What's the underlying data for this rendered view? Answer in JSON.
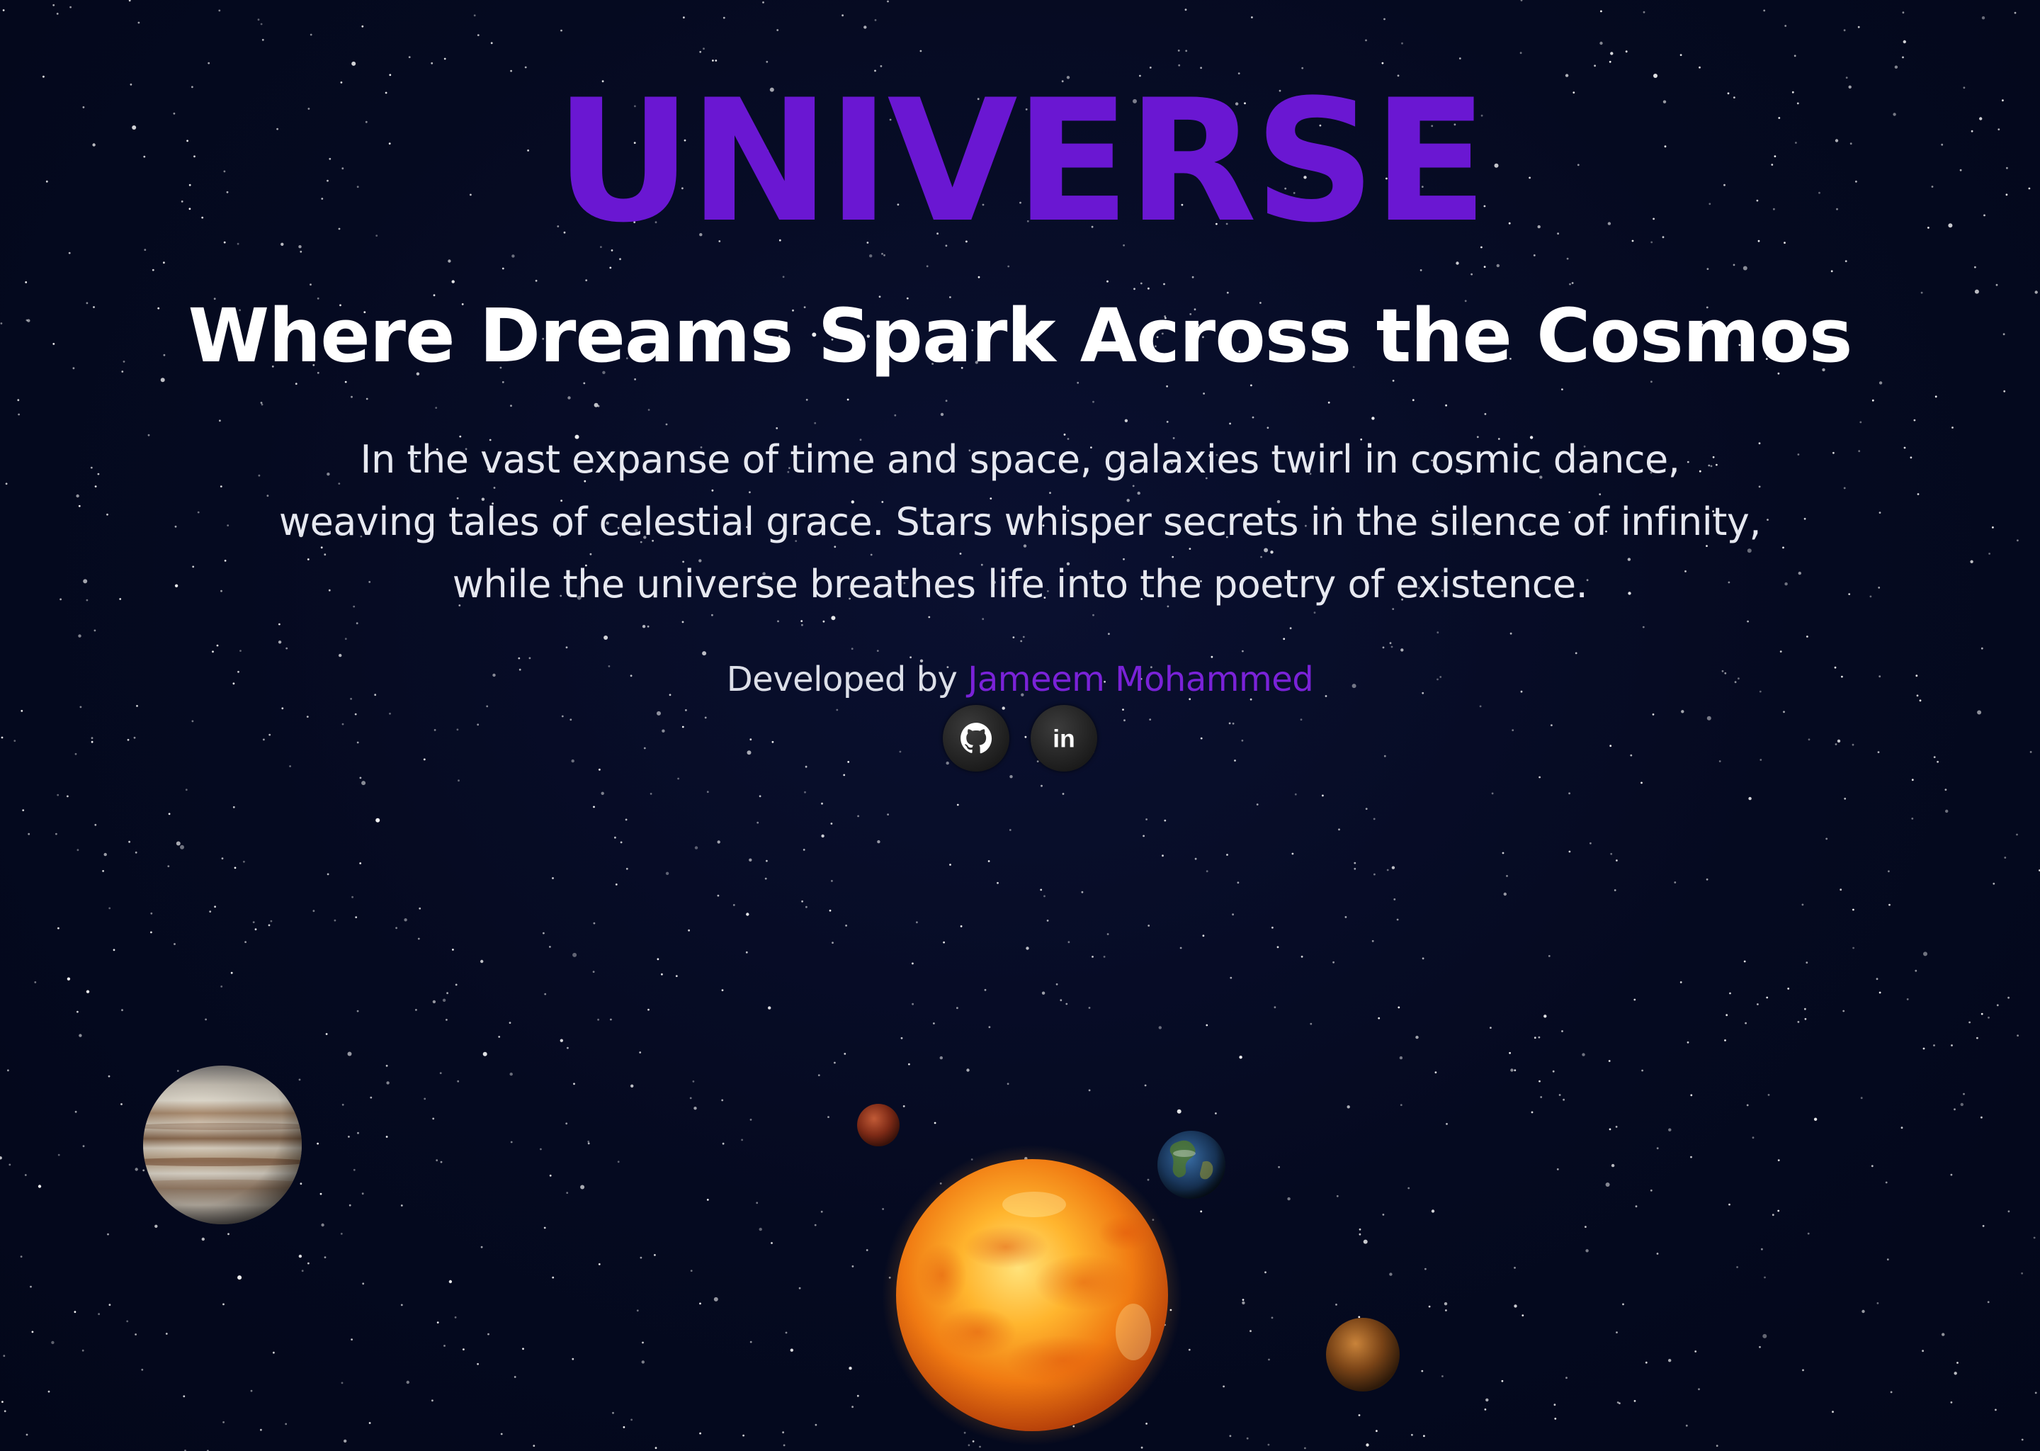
{
  "hero": {
    "title": "UNIVERSE",
    "subtitle": "Where Dreams Spark Across the Cosmos",
    "description": "In the vast expanse of time and space, galaxies twirl in cosmic dance, weaving tales of celestial grace. Stars whisper secrets in the silence of infinity, while the universe breathes life into the poetry of existence."
  },
  "credit": {
    "prefix": "Developed by",
    "author": "Jameem Mohammed"
  },
  "socials": [
    {
      "icon": "github-icon"
    },
    {
      "icon": "linkedin-icon",
      "glyph": "in"
    }
  ],
  "planets": [
    "jupiter",
    "mars",
    "earth",
    "sun",
    "mercury"
  ],
  "colors": {
    "background": "#050a20",
    "title": "#6a17d2",
    "author_link": "#7a22d8",
    "text": "#ffffff"
  }
}
